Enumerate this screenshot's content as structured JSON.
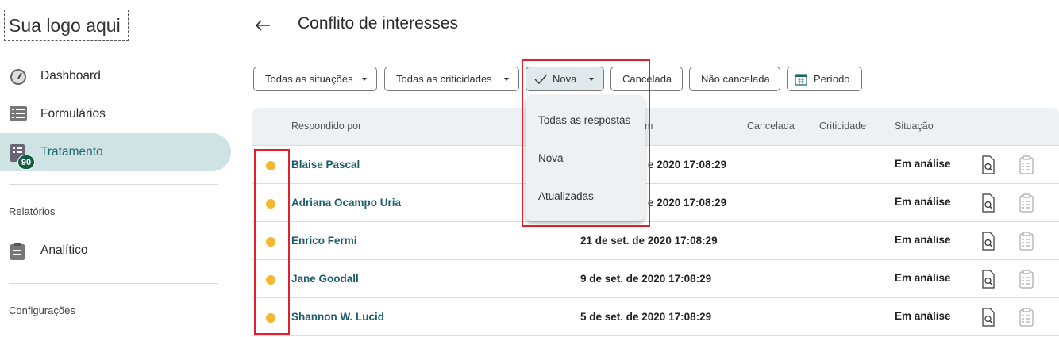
{
  "logo": {
    "text": "Sua logo aqui"
  },
  "sidebar": {
    "items": [
      {
        "label": "Dashboard"
      },
      {
        "label": "Formulários"
      },
      {
        "label": "Tratamento",
        "badge": "90"
      }
    ],
    "sections": [
      {
        "title": "Relatórios",
        "items": [
          {
            "label": "Analítico"
          }
        ]
      },
      {
        "title": "Configurações"
      }
    ]
  },
  "header": {
    "title": "Conflito de interesses"
  },
  "filters": {
    "situacoes": "Todas as situações",
    "criticidades": "Todas as criticidades",
    "nova": "Nova",
    "cancelada": "Cancelada",
    "nao_cancelada": "Não cancelada",
    "periodo": "Período"
  },
  "dropdown": {
    "options": [
      "Todas as respostas",
      "Nova",
      "Atualizadas"
    ]
  },
  "table": {
    "columns": {
      "respondido_por": "Respondido por",
      "em_partial": "m",
      "cancelada": "Cancelada",
      "criticidade": "Criticidade",
      "situacao": "Situação"
    },
    "rows": [
      {
        "name": "Blaise Pascal",
        "date": "e 2020 17:08:29",
        "status": "Em análise"
      },
      {
        "name": "Adriana Ocampo Uria",
        "date": "e 2020 17:08:29",
        "status": "Em análise"
      },
      {
        "name": "Enrico Fermi",
        "date": "21 de set. de 2020 17:08:29",
        "status": "Em análise"
      },
      {
        "name": "Jane Goodall",
        "date": "9 de set. de 2020 17:08:29",
        "status": "Em análise"
      },
      {
        "name": "Shannon W. Lucid",
        "date": "5 de set. de 2020 17:08:29",
        "status": "Em análise"
      }
    ]
  },
  "colors": {
    "accent": "#1b5c6b",
    "active_nav_bg": "#cfe3e5",
    "status_dot": "#f5b731",
    "badge": "#125c40",
    "highlight": "#e0212d"
  }
}
